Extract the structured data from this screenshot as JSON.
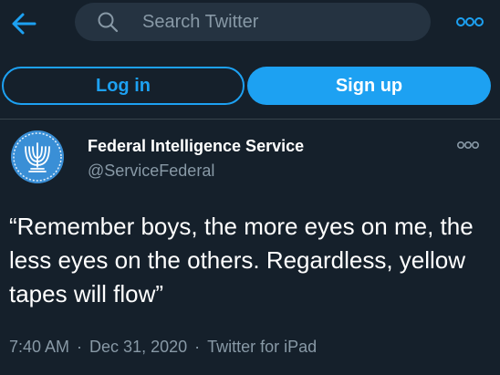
{
  "header": {
    "search_placeholder": "Search Twitter",
    "back_icon": "arrow-left-icon",
    "search_icon": "magnifier-icon",
    "more_icon": "more-dots-icon"
  },
  "auth": {
    "login_label": "Log in",
    "signup_label": "Sign up"
  },
  "tweet": {
    "author_name": "Federal Intelligence Service",
    "author_handle": "@ServiceFederal",
    "text": "“Remember boys, the more eyes on me, the less eyes on the others. Regardless, yellow tapes will flow”",
    "time": "7:40 AM",
    "date": "Dec 31, 2020",
    "source": "Twitter for iPad",
    "separator": "·"
  },
  "colors": {
    "background": "#15202b",
    "accent": "#1da1f2",
    "secondary_text": "#8899a6",
    "search_bg": "#253341",
    "divider": "#38444d"
  }
}
